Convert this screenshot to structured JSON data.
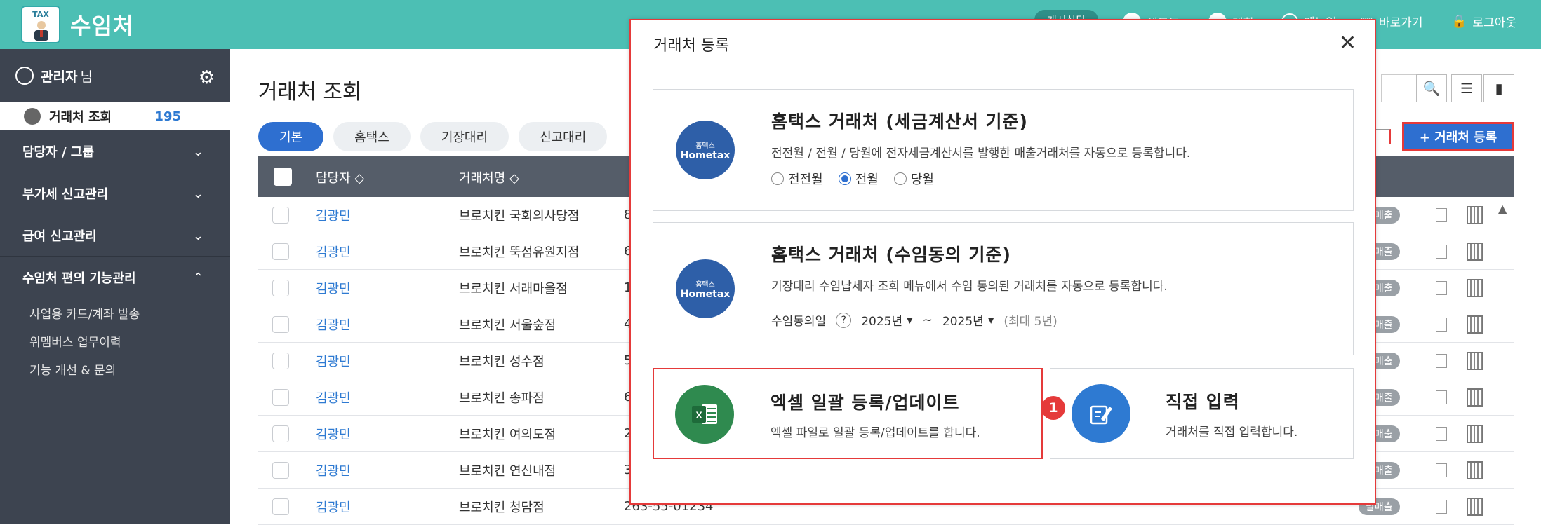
{
  "header": {
    "app_title": "수임처",
    "logo_label": "TAX",
    "status_pill": "캐시상담",
    "items": [
      "세무톡",
      "대화",
      "메뉴얼"
    ],
    "shortcut_label": "바로가기",
    "logout_label": "로그아웃"
  },
  "sidebar": {
    "admin_name": "관리자",
    "admin_suffix": "님",
    "active_item": {
      "label": "거래처 조회",
      "count": "195"
    },
    "sections": [
      {
        "label": "담당자 / 그룹",
        "chev": "⌄"
      },
      {
        "label": "부가세 신고관리",
        "chev": "⌄"
      },
      {
        "label": "급여 신고관리",
        "chev": "⌄"
      },
      {
        "label": "수임처 편의 기능관리",
        "chev": "⌃"
      }
    ],
    "sub_items": [
      "사업용 카드/계좌 발송",
      "위멤버스 업무이력",
      "기능 개선 & 문의"
    ]
  },
  "main": {
    "page_title": "거래처 조회",
    "tabs": [
      {
        "label": "기본",
        "active": true
      },
      {
        "label": "홈택스",
        "active": false
      },
      {
        "label": "기장대리",
        "active": false
      },
      {
        "label": "신고대리",
        "active": false
      }
    ],
    "register_button": "+ 거래처 등록",
    "columns": [
      "담당자 ◇",
      "거래처명 ◇"
    ],
    "rows": [
      {
        "manager": "김광민",
        "client": "브로치킨 국회의사당점",
        "num": "8"
      },
      {
        "manager": "김광민",
        "client": "브로치킨 뚝섬유원지점",
        "num": "6"
      },
      {
        "manager": "김광민",
        "client": "브로치킨 서래마을점",
        "num": "1"
      },
      {
        "manager": "김광민",
        "client": "브로치킨 서울숲점",
        "num": "4"
      },
      {
        "manager": "김광민",
        "client": "브로치킨 성수점",
        "num": "5"
      },
      {
        "manager": "김광민",
        "client": "브로치킨 송파점",
        "num": "6"
      },
      {
        "manager": "김광민",
        "client": "브로치킨 여의도점",
        "num": "2"
      },
      {
        "manager": "김광민",
        "client": "브로치킨 연신내점",
        "num": "3"
      },
      {
        "manager": "김광민",
        "client": "브로치킨 청담점",
        "num": "263-55-01234"
      }
    ],
    "row_badge": "달매출"
  },
  "modal": {
    "title": "거래처 등록",
    "close": "✕",
    "card1": {
      "title": "홈택스 거래처 (세금계산서 기준)",
      "desc": "전전월 / 전월 / 당월에 전자세금계산서를 발행한 매출거래처를 자동으로 등록합니다.",
      "options": [
        {
          "label": "전전월",
          "selected": false
        },
        {
          "label": "전월",
          "selected": true
        },
        {
          "label": "당월",
          "selected": false
        }
      ]
    },
    "card2": {
      "title": "홈택스 거래처 (수임동의 기준)",
      "desc": "기장대리 수임납세자 조회 메뉴에서 수임 동의된 거래처를 자동으로 등록합니다.",
      "agree_label": "수임동의일",
      "help": "?",
      "from_year": "2025년",
      "tilde": "~",
      "to_year": "2025년",
      "max_note": "(최대 5년)"
    },
    "card3": {
      "title": "엑셀 일괄 등록/업데이트",
      "desc": "엑셀 파일로 일괄 등록/업데이트를 합니다."
    },
    "card4": {
      "title": "직접 입력",
      "desc": "거래처를 직접 입력합니다."
    },
    "step_marker": "1",
    "hometax_logo": {
      "small": "홈택스",
      "big": "Hometax"
    }
  },
  "colors": {
    "header": "#4cbfb4",
    "sidebar": "#3d4450",
    "primary": "#2e6fd0",
    "highlight": "#e53a3a"
  }
}
